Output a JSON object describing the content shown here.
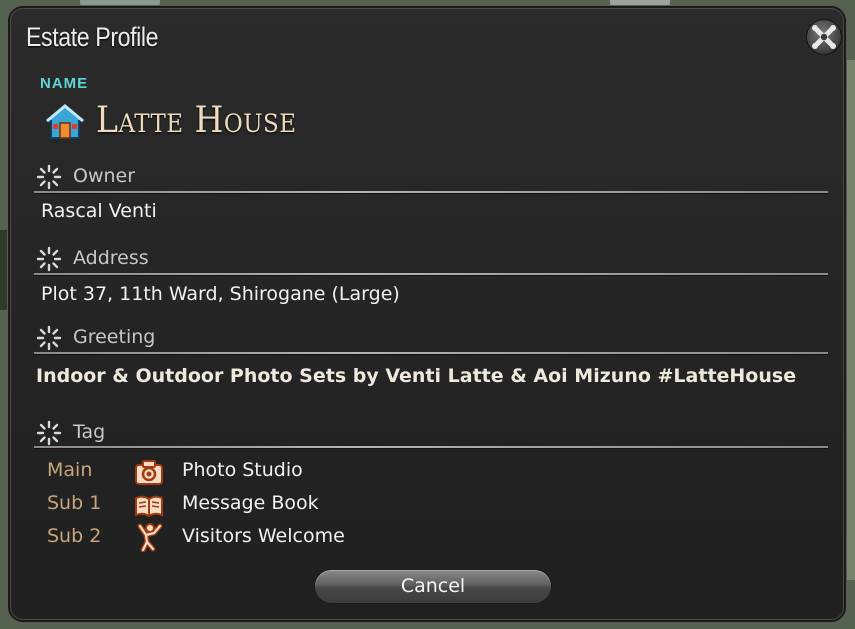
{
  "window": {
    "title": "Estate Profile"
  },
  "name": {
    "label": "NAME",
    "value": "Latte House",
    "icon": "house-icon"
  },
  "owner": {
    "label": "Owner",
    "value": "Rascal Venti"
  },
  "address": {
    "label": "Address",
    "value": "Plot 37, 11th Ward, Shirogane (Large)"
  },
  "greeting": {
    "label": "Greeting",
    "value": "Indoor & Outdoor Photo Sets by Venti Latte & Aoi Mizuno #LatteHouse"
  },
  "tag": {
    "label": "Tag",
    "items": [
      {
        "slot": "Main",
        "icon": "camera-icon",
        "text": "Photo Studio"
      },
      {
        "slot": "Sub 1",
        "icon": "book-icon",
        "text": "Message Book"
      },
      {
        "slot": "Sub 2",
        "icon": "waving-person-icon",
        "text": "Visitors Welcome"
      }
    ]
  },
  "buttons": {
    "cancel": "Cancel"
  },
  "colors": {
    "name_label": "#5fd4d6",
    "estate_name": "#efdcbd",
    "tag_slot": "#c9a57a",
    "window_bg": "#262626"
  }
}
